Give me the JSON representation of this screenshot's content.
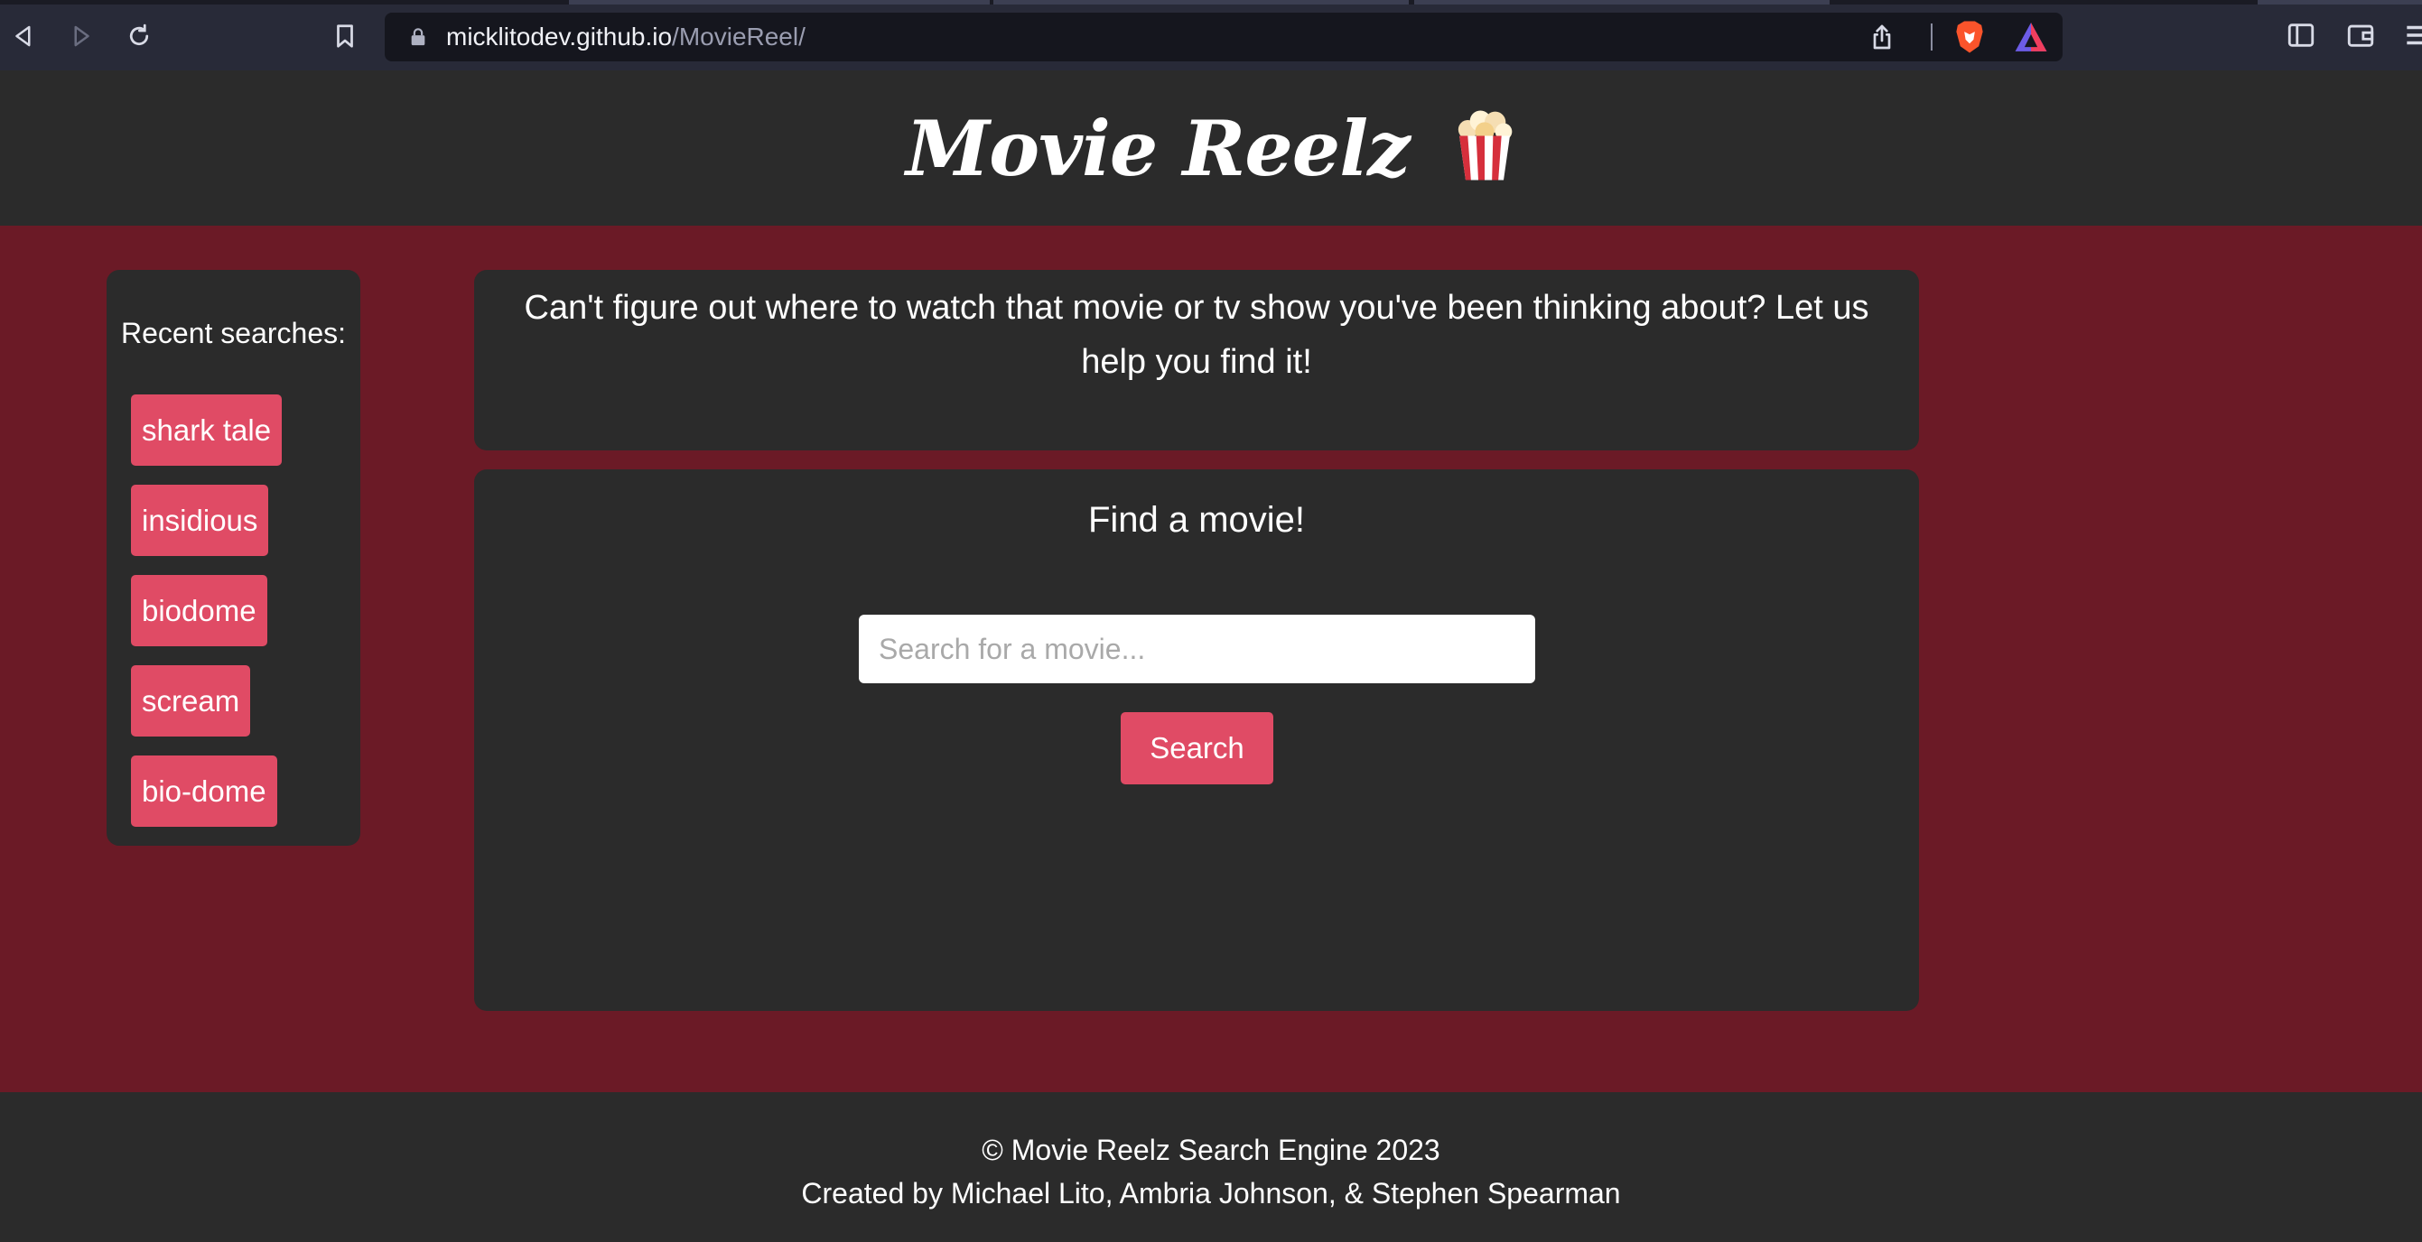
{
  "browser": {
    "url_host": "micklitodev.github.io",
    "url_path": "/MovieReel/",
    "icons": {
      "back": "back-icon",
      "forward": "forward-icon",
      "reload": "reload-icon",
      "bookmark": "bookmark-icon",
      "lock": "lock-icon",
      "share": "share-icon",
      "brave_shields": "brave-lion-icon",
      "brave_rewards": "rewards-triangle-icon",
      "sidebar": "sidebar-icon",
      "wallet": "wallet-icon",
      "menu": "menu-icon"
    }
  },
  "header": {
    "title": "Movie Reelz",
    "logo_icon": "popcorn-icon"
  },
  "sidebar": {
    "heading": "Recent searches:",
    "items": [
      {
        "label": "shark tale"
      },
      {
        "label": "insidious"
      },
      {
        "label": "biodome"
      },
      {
        "label": "scream"
      },
      {
        "label": "bio-dome"
      }
    ]
  },
  "intro": {
    "text": "Can't figure out where to watch that movie or tv show you've been thinking about? Let us help you find it!"
  },
  "search": {
    "heading": "Find a movie!",
    "placeholder": "Search for a movie...",
    "value": "",
    "button_label": "Search"
  },
  "footer": {
    "copyright": "© Movie Reelz Search Engine 2023",
    "credits": "Created by Michael Lito, Ambria Johnson, & Stephen Spearman"
  },
  "colors": {
    "page_background": "#6b1a26",
    "panel": "#2b2b2b",
    "accent_button": "#e04b65",
    "text": "#ffffff",
    "browser_chrome": "#282a38"
  }
}
